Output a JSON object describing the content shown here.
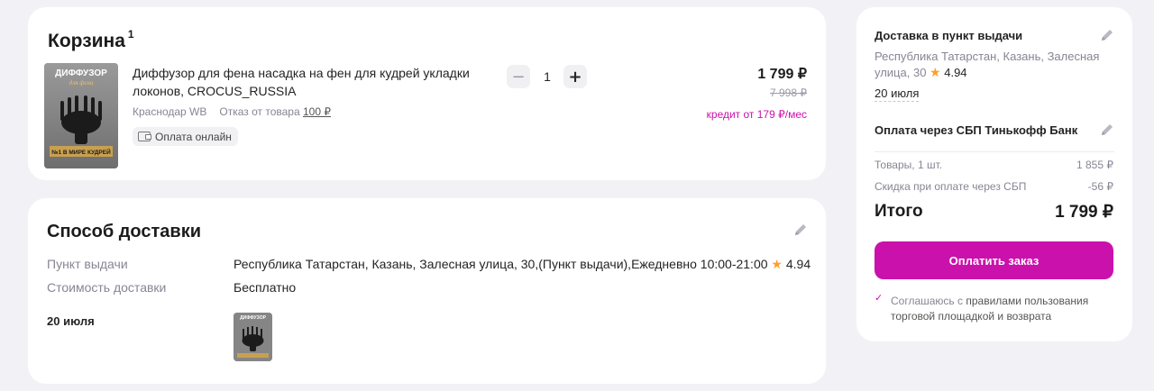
{
  "cart": {
    "title": "Корзина",
    "count": "1",
    "product": {
      "image_caption_top": "ДИФФУЗОР",
      "image_caption_sub": "для фена",
      "image_caption_bottom": "№1 В МИРЕ КУДРЕЙ",
      "name": "Диффузор для фена насадка на фен для кудрей укладки локонов, CROCUS_RUSSIA",
      "warehouse": "Краснодар WB",
      "return_label": "Отказ от товара",
      "return_price": "100 ₽",
      "pay_badge": "Оплата онлайн",
      "quantity": "1",
      "minus": "−",
      "plus": "+",
      "price": "1 799 ₽",
      "old_price": "7 998 ₽",
      "credit": "кредит от 179 ₽/мес"
    }
  },
  "delivery": {
    "title": "Способ доставки",
    "pickup_label": "Пункт выдачи",
    "pickup_value": "Республика Татарстан, Казань, Залесная улица, 30,(Пункт выдачи),Ежедневно 10:00-21:00",
    "rating": "4.94",
    "cost_label": "Стоимость доставки",
    "cost_value": "Бесплатно",
    "date": "20 июля"
  },
  "summary": {
    "delivery_head": "Доставка в пункт выдачи",
    "address": "Республика Татарстан, Казань, Залесная улица, 30",
    "rating": "4.94",
    "date": "20 июля",
    "payment": "Оплата через СБП Тинькофф Банк",
    "goods_label": "Товары, 1 шт.",
    "goods_value": "1 855 ₽",
    "discount_label": "Скидка при оплате через СБП",
    "discount_value": "-56 ₽",
    "total_label": "Итого",
    "total_value": "1 799 ₽",
    "pay_button": "Оплатить заказ",
    "agree_prefix": "Соглашаюсь с",
    "agree_link": "правилами пользования торговой площадкой и возврата"
  },
  "colors": {
    "accent": "#cb11ab",
    "star": "#ff9e2c",
    "muted": "#868695",
    "background": "#f2f2f6"
  },
  "icons": {
    "star": "star-icon",
    "pencil": "pencil-icon",
    "wallet": "wallet-icon",
    "check": "check-icon"
  }
}
